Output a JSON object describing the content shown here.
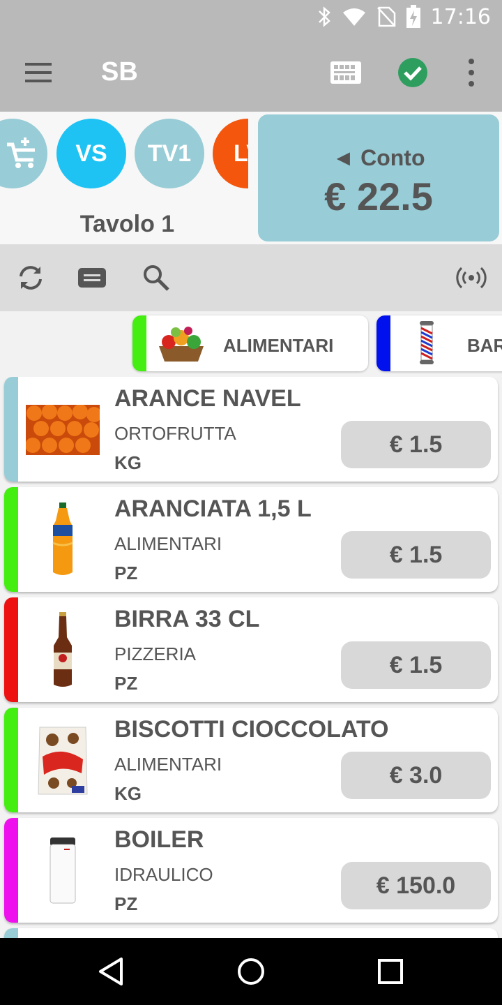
{
  "status_bar": {
    "time": "17:16",
    "icons": [
      "bluetooth-icon",
      "wifi-icon",
      "no-sim-icon",
      "battery-charging-icon"
    ]
  },
  "app_bar": {
    "title": "SB",
    "icons": [
      "menu-icon",
      "barcode-icon",
      "check-circle-icon",
      "more-vert-icon"
    ],
    "check_color": "#2e9e5f"
  },
  "tables": {
    "circles": [
      {
        "label": "",
        "icon": "add-cart-icon",
        "color": "#98ccd6"
      },
      {
        "label": "VS",
        "color": "#1ec3f4"
      },
      {
        "label": "TV1",
        "color": "#98ccd6"
      },
      {
        "label": "LV",
        "color": "#f4560e"
      }
    ],
    "current_table": "Tavolo 1"
  },
  "bill": {
    "label": "◄ Conto",
    "total": "€ 22.5",
    "color": "#98ccd6"
  },
  "toolbar": {
    "icons": [
      "refresh-icon",
      "keyboard-icon",
      "search-icon",
      "nfc-icon"
    ]
  },
  "categories": [
    {
      "label": "ALIMENTARI",
      "color": "#44ee11",
      "icon": "food-basket-icon"
    },
    {
      "label": "BARBIERE",
      "color": "#0011ee",
      "icon": "barber-pole-icon"
    }
  ],
  "products": [
    {
      "name": "ARANCE NAVEL",
      "category": "ORTOFRUTTA",
      "unit": "KG",
      "price": "€ 1.5",
      "color": "#98ccd6",
      "icon": "oranges-icon"
    },
    {
      "name": "ARANCIATA 1,5 L",
      "category": "ALIMENTARI",
      "unit": "PZ",
      "price": "€ 1.5",
      "color": "#44ee11",
      "icon": "soda-bottle-icon"
    },
    {
      "name": "BIRRA 33 CL",
      "category": "PIZZERIA",
      "unit": "PZ",
      "price": "€ 1.5",
      "color": "#ee1111",
      "icon": "beer-bottle-icon"
    },
    {
      "name": "BISCOTTI CIOCCOLATO",
      "category": "ALIMENTARI",
      "unit": "KG",
      "price": "€ 3.0",
      "color": "#44ee11",
      "icon": "cookies-bag-icon"
    },
    {
      "name": "BOILER",
      "category": "IDRAULICO",
      "unit": "PZ",
      "price": "€ 150.0",
      "color": "#ee11ee",
      "icon": "boiler-icon"
    }
  ],
  "nav_bar": {
    "icons": [
      "back-icon",
      "home-icon",
      "recents-icon"
    ]
  }
}
